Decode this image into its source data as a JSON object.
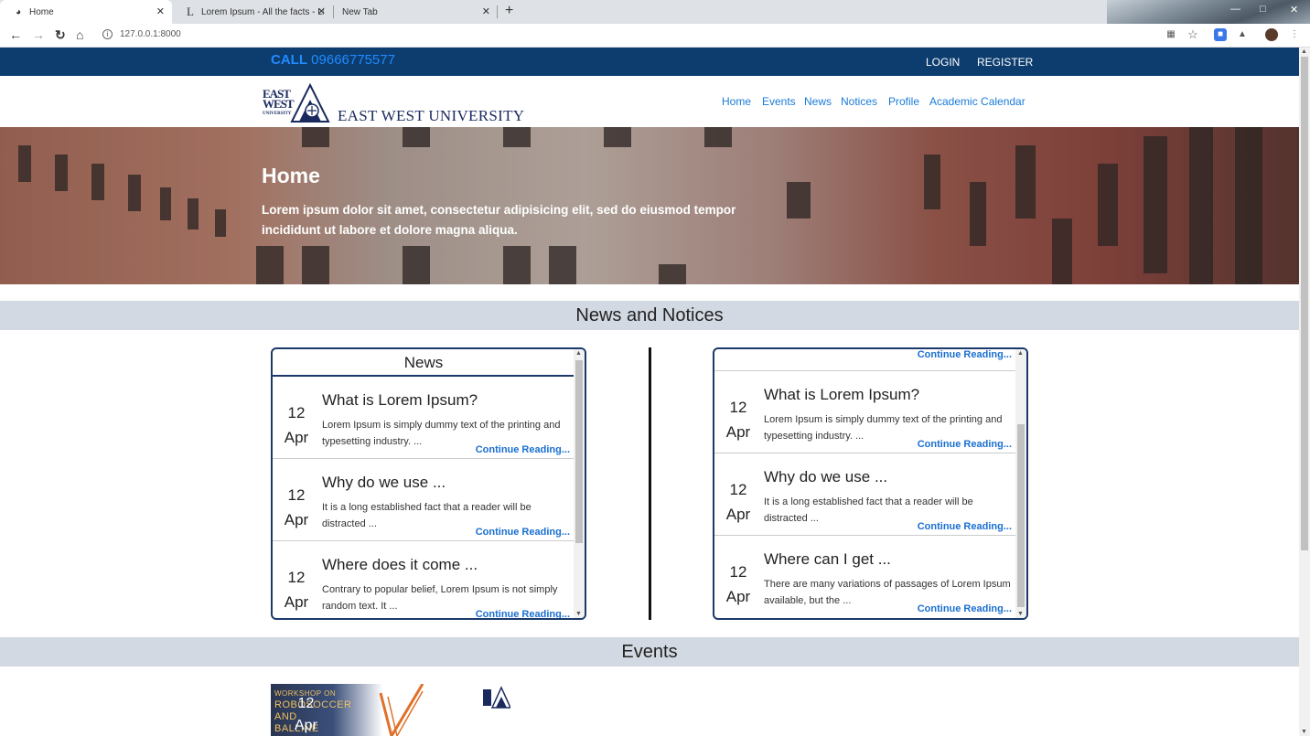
{
  "browser": {
    "tabs": [
      {
        "title": "Home",
        "active": true
      },
      {
        "title": "Lorem Ipsum - All the facts - Lip",
        "active": false
      },
      {
        "title": "New Tab",
        "active": false
      }
    ],
    "url": "127.0.0.1:8000"
  },
  "topbar": {
    "call_label": "CALL",
    "phone": "09666775577",
    "login": "LOGIN",
    "register": "REGISTER"
  },
  "logo": {
    "east": "EAST",
    "west": "WEST",
    "university_small": "UNIVERSITY",
    "name": "EAST WEST UNIVERSITY"
  },
  "nav": [
    "Home",
    "Events",
    "News",
    "Notices",
    "Profile",
    "Academic Calendar"
  ],
  "hero": {
    "title": "Home",
    "text": "Lorem ipsum dolor sit amet, consectetur adipisicing elit, sed do eiusmod tempor incididunt ut labore et dolore magna aliqua."
  },
  "sections": {
    "news_notices": "News and Notices",
    "events": "Events"
  },
  "news": {
    "heading": "News",
    "items": [
      {
        "day": "12",
        "month": "Apr",
        "title": "What is Lorem Ipsum?",
        "body": "Lorem Ipsum is simply dummy text of the printing and typesetting industry. ...",
        "more": "Continue Reading..."
      },
      {
        "day": "12",
        "month": "Apr",
        "title": "Why do we use ...",
        "body": "It is a long established fact that a reader will be distracted ...",
        "more": "Continue Reading..."
      },
      {
        "day": "12",
        "month": "Apr",
        "title": "Where does it come ...",
        "body": "Contrary to popular belief, Lorem Ipsum is not simply random text. It ...",
        "more": "Continue Reading..."
      }
    ]
  },
  "notices": {
    "top_more": "Continue Reading...",
    "items": [
      {
        "day": "12",
        "month": "Apr",
        "title": "What is Lorem Ipsum?",
        "body": "Lorem Ipsum is simply dummy text of the printing and typesetting industry. ...",
        "more": "Continue Reading..."
      },
      {
        "day": "12",
        "month": "Apr",
        "title": "Why do we use ...",
        "body": "It is a long established fact that a reader will be distracted ...",
        "more": "Continue Reading..."
      },
      {
        "day": "12",
        "month": "Apr",
        "title": "Where can I get ...",
        "body": "There are many variations of passages of Lorem Ipsum available, but the ...",
        "more": "Continue Reading..."
      }
    ]
  },
  "event": {
    "day": "12",
    "month": "Apr",
    "poster_lines": [
      "WORKSHOP ON",
      "ROBOSOCCER",
      "AND",
      "BALLINE"
    ]
  },
  "colors": {
    "topbar": "#0d3c6e",
    "accent_blue": "#1a7bd8",
    "phone_blue": "#1f8cff",
    "section_band": "#d3d9e2",
    "panel_border": "#1b3a6b"
  }
}
